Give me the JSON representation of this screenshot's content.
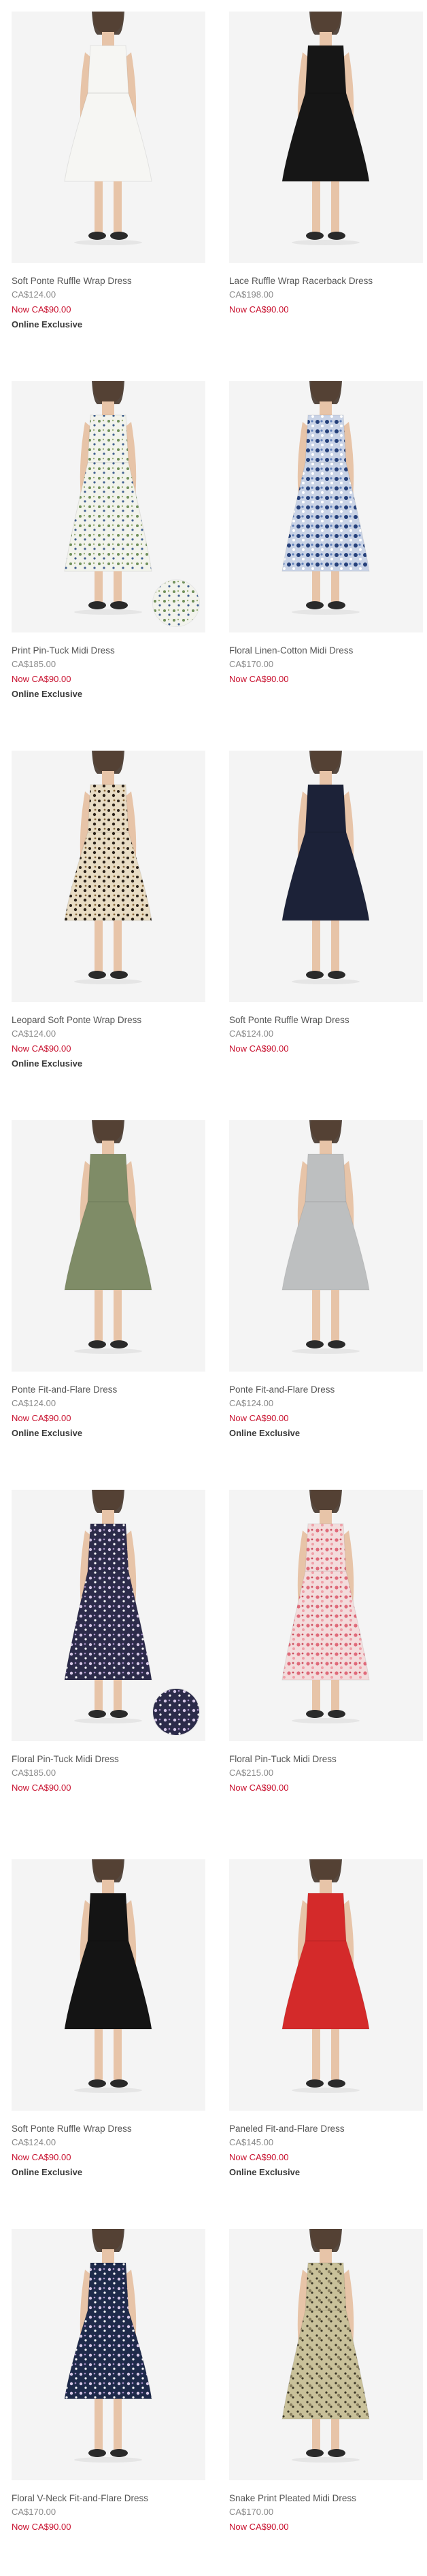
{
  "products": [
    {
      "name": "Soft Ponte Ruffle Wrap Dress",
      "was": "CA$124.00",
      "now": "Now CA$90.00",
      "badge": "Online Exclusive",
      "dress_color": "#f6f6f3",
      "pattern": "none",
      "swatch": false
    },
    {
      "name": "Lace Ruffle Wrap Racerback Dress",
      "was": "CA$198.00",
      "now": "Now CA$90.00",
      "badge": "",
      "dress_color": "#161616",
      "pattern": "none",
      "swatch": false
    },
    {
      "name": "Print Pin-Tuck Midi Dress",
      "was": "CA$185.00",
      "now": "Now CA$90.00",
      "badge": "Online Exclusive",
      "dress_color": "#f2f3ec",
      "pattern": "floral-green",
      "swatch": true
    },
    {
      "name": "Floral Linen-Cotton Midi Dress",
      "was": "CA$170.00",
      "now": "Now CA$90.00",
      "badge": "",
      "dress_color": "#c9d3e6",
      "pattern": "floral-blue",
      "swatch": false
    },
    {
      "name": "Leopard Soft Ponte Wrap Dress",
      "was": "CA$124.00",
      "now": "Now CA$90.00",
      "badge": "Online Exclusive",
      "dress_color": "#e8dcc4",
      "pattern": "leopard",
      "swatch": false
    },
    {
      "name": "Soft Ponte Ruffle Wrap Dress",
      "was": "CA$124.00",
      "now": "Now CA$90.00",
      "badge": "",
      "dress_color": "#1c2238",
      "pattern": "none",
      "swatch": false
    },
    {
      "name": "Ponte Fit-and-Flare Dress",
      "was": "CA$124.00",
      "now": "Now CA$90.00",
      "badge": "Online Exclusive",
      "dress_color": "#7f8c67",
      "pattern": "none",
      "swatch": false
    },
    {
      "name": "Ponte Fit-and-Flare Dress",
      "was": "CA$124.00",
      "now": "Now CA$90.00",
      "badge": "Online Exclusive",
      "dress_color": "#bdbfc0",
      "pattern": "none",
      "swatch": false
    },
    {
      "name": "Floral Pin-Tuck Midi Dress",
      "was": "CA$185.00",
      "now": "Now CA$90.00",
      "badge": "",
      "dress_color": "#2c2b4a",
      "pattern": "floral-navy",
      "swatch": true
    },
    {
      "name": "Floral Pin-Tuck Midi Dress",
      "was": "CA$215.00",
      "now": "Now CA$90.00",
      "badge": "",
      "dress_color": "#f3dcdc",
      "pattern": "floral-pink",
      "swatch": false
    },
    {
      "name": "Soft Ponte Ruffle Wrap Dress",
      "was": "CA$124.00",
      "now": "Now CA$90.00",
      "badge": "Online Exclusive",
      "dress_color": "#141414",
      "pattern": "none",
      "swatch": false
    },
    {
      "name": "Paneled Fit-and-Flare Dress",
      "was": "CA$145.00",
      "now": "Now CA$90.00",
      "badge": "Online Exclusive",
      "dress_color": "#d42a2a",
      "pattern": "none",
      "swatch": false
    },
    {
      "name": "Floral V-Neck Fit-and-Flare Dress",
      "was": "CA$170.00",
      "now": "Now CA$90.00",
      "badge": "",
      "dress_color": "#1e2a4a",
      "pattern": "floral-navy",
      "swatch": false
    },
    {
      "name": "Snake Print Pleated Midi Dress",
      "was": "CA$170.00",
      "now": "Now CA$90.00",
      "badge": "",
      "dress_color": "#c9c19a",
      "pattern": "snake",
      "swatch": false
    }
  ]
}
